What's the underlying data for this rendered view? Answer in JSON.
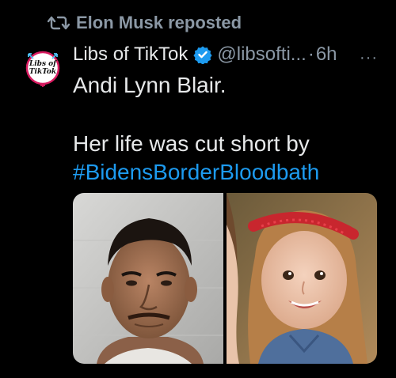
{
  "repost": {
    "label": "Elon Musk reposted",
    "icon": "repost-icon"
  },
  "author": {
    "display_name": "Libs of TikTok",
    "verified_icon": "verified-badge-icon",
    "handle": "@libsofti...",
    "separator": "·",
    "time": "6h",
    "avatar_text_line1": "Libs of",
    "avatar_text_line2": "TikTok"
  },
  "more_label": "···",
  "tweet": {
    "line1": "Andi Lynn Blair.",
    "line2": "Her life was cut short by",
    "hashtag": "#BidensBorderBloodbath"
  },
  "colors": {
    "background": "#000000",
    "text": "#e7e9ea",
    "muted": "#8b98a5",
    "link": "#1d9bf0",
    "verified": "#1d9bf0"
  }
}
